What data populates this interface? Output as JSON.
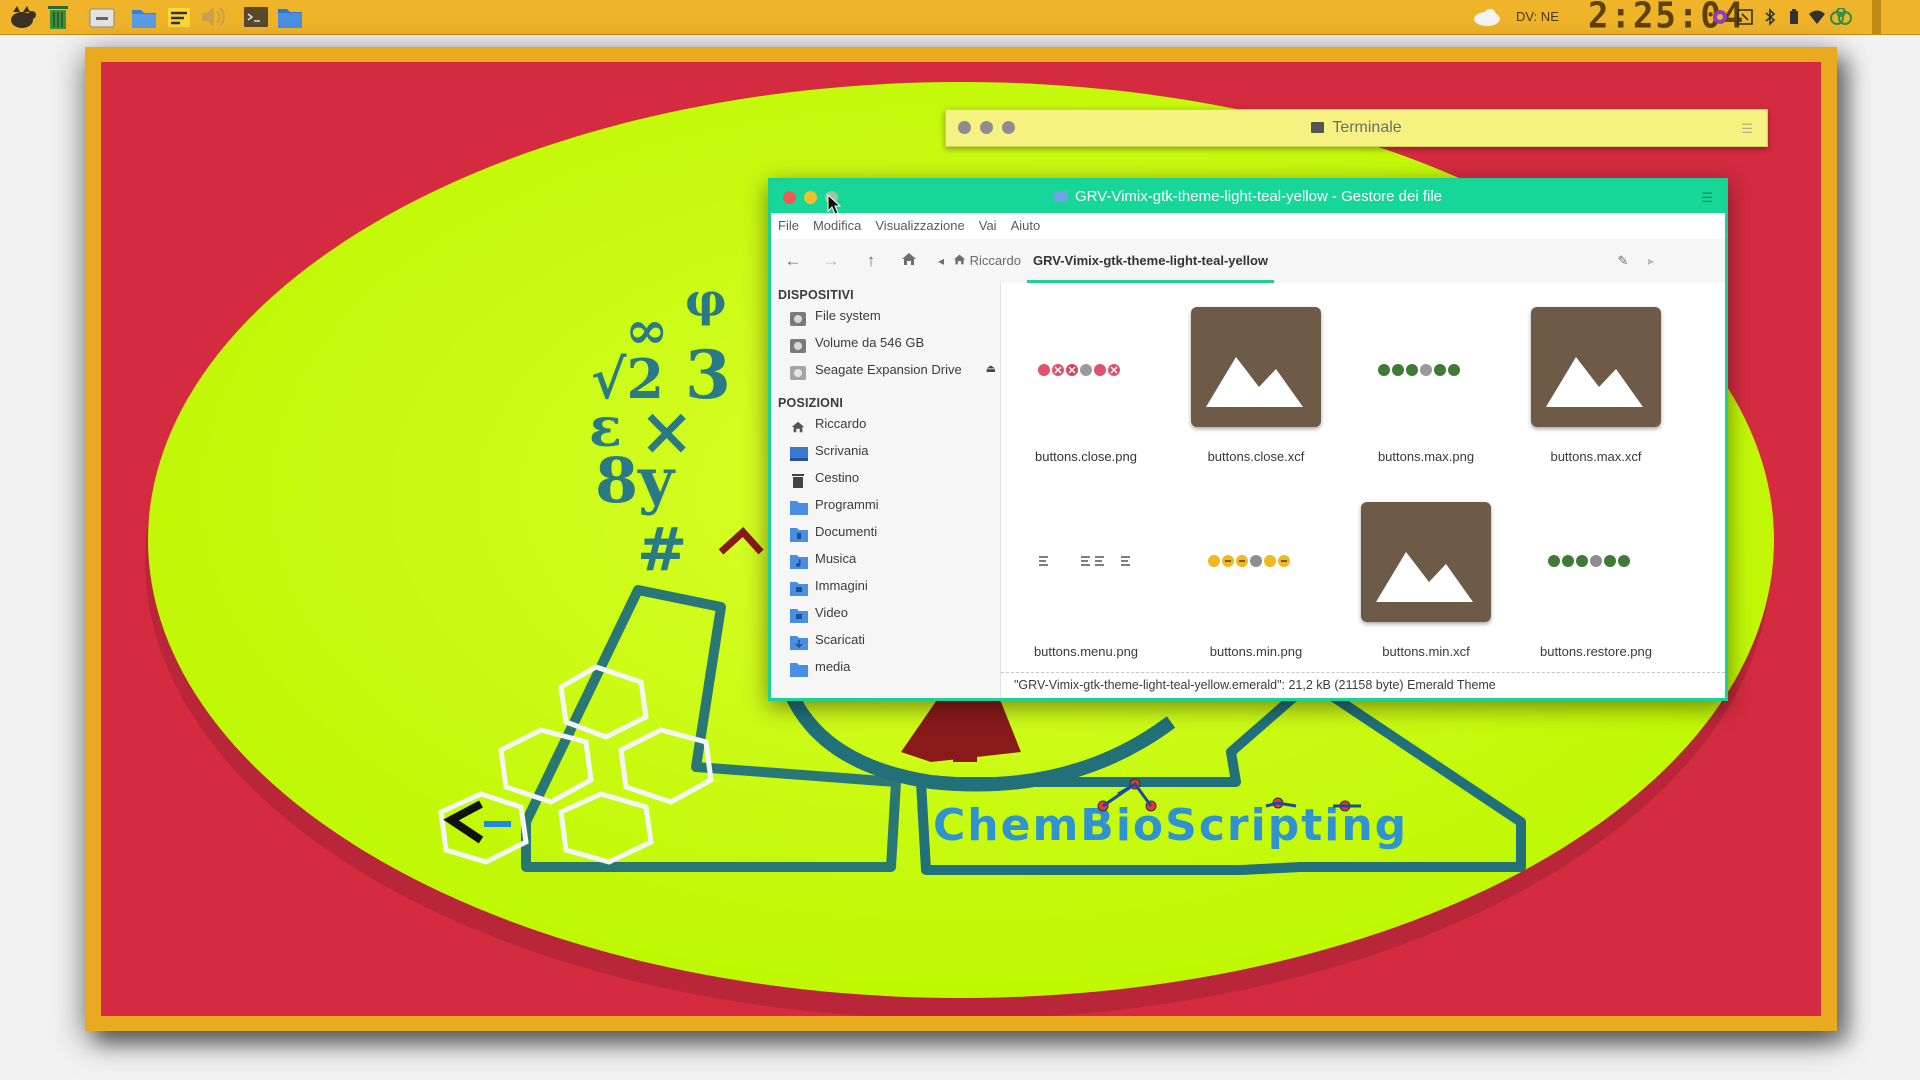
{
  "panel": {
    "keyboard_layout": "DV: NE",
    "clock": "2:25:04",
    "launchers": [
      "whisker-menu-icon",
      "trash-icon",
      "drive-icon",
      "files-icon",
      "notes-icon",
      "volume-icon",
      "terminal-icon",
      "folder-icon"
    ]
  },
  "terminal": {
    "title": "Terminale"
  },
  "file_manager": {
    "title": "GRV-Vimix-gtk-theme-light-teal-yellow - Gestore dei file",
    "menu": [
      "File",
      "Modifica",
      "Visualizzazione",
      "Vai",
      "Aiuto"
    ],
    "breadcrumb": {
      "home": "Riccardo",
      "current": "GRV-Vimix-gtk-theme-light-teal-yellow"
    },
    "sidebar": {
      "devices_header": "DISPOSITIVI",
      "devices": [
        "File system",
        "Volume da 546 GB",
        "Seagate Expansion Drive"
      ],
      "places_header": "POSIZIONI",
      "places": [
        "Riccardo",
        "Scrivania",
        "Cestino",
        "Programmi",
        "Documenti",
        "Musica",
        "Immagini",
        "Video",
        "Scaricati",
        "media"
      ]
    },
    "files": [
      {
        "name": "buttons.close.png"
      },
      {
        "name": "buttons.close.xcf"
      },
      {
        "name": "buttons.max.png"
      },
      {
        "name": "buttons.max.xcf"
      },
      {
        "name": "buttons.menu.png"
      },
      {
        "name": "buttons.min.png"
      },
      {
        "name": "buttons.min.xcf"
      },
      {
        "name": "buttons.restore.png"
      }
    ],
    "status": "\"GRV-Vimix-gtk-theme-light-teal-yellow.emerald\": 21,2 kB (21158 byte) Emerald Theme"
  },
  "wallpaper": {
    "logo_text": "ChemBioScripting",
    "formula_text": [
      "φ",
      "∞",
      "√2",
      "3",
      "ε",
      "×",
      "8y",
      "#"
    ]
  },
  "colors": {
    "panel": "#efb429",
    "titlebar": "#16d797",
    "terminal_bar": "#f6f281",
    "wall_red": "#d42b40",
    "wall_lime": "#c2fa00",
    "logo_teal": "#21707a"
  }
}
